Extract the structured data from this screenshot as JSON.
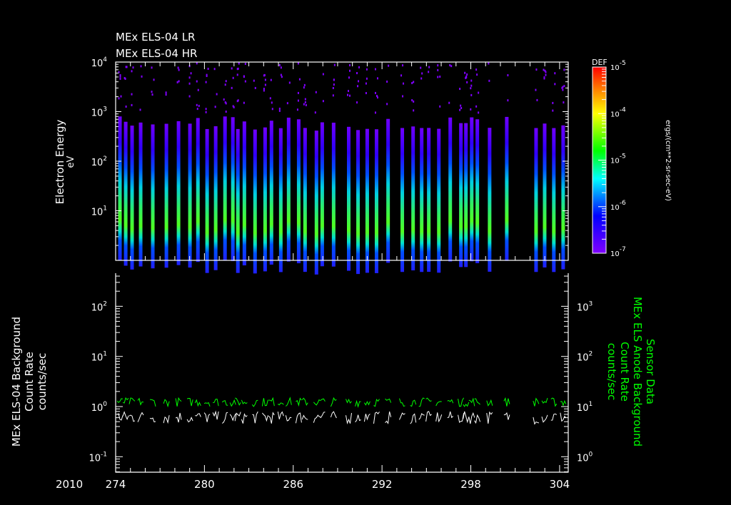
{
  "chart_data": [
    {
      "type": "heatmap",
      "titles": [
        "MEx ELS-04 LR",
        "MEx ELS-04 HR"
      ],
      "ylabel": "Electron Energy",
      "yunits": "eV",
      "yscale": "log",
      "ylim": [
        1,
        10000
      ],
      "yticks": [
        {
          "base": "10",
          "exp": "1"
        },
        {
          "base": "10",
          "exp": "2"
        },
        {
          "base": "10",
          "exp": "3"
        },
        {
          "base": "10",
          "exp": "4"
        }
      ],
      "ytick_values": [
        10,
        100,
        1000,
        10000
      ],
      "xlim": [
        274,
        304.6
      ],
      "pass_days": [
        274.29,
        274.68,
        275.11,
        275.69,
        276.51,
        277.43,
        278.25,
        279.02,
        279.56,
        280.18,
        280.76,
        281.39,
        281.92,
        282.26,
        282.7,
        283.42,
        284.1,
        284.53,
        285.16,
        285.69,
        286.37,
        286.8,
        287.57,
        287.96,
        288.73,
        289.75,
        290.38,
        291.0,
        291.63,
        292.41,
        293.37,
        294.1,
        294.68,
        295.16,
        295.84,
        296.61,
        297.33,
        297.67,
        298.06,
        298.44,
        299.27,
        300.43,
        302.41,
        302.99,
        303.61,
        304.24
      ],
      "band_top_energy_eV": 800,
      "peak_energy_eV": 15,
      "colorbar": {
        "title": "DEF",
        "units": "ergs/(cm**2-sr-sec-eV)",
        "scale": "log",
        "range": [
          1e-07,
          0.001
        ],
        "ticks": [
          {
            "base": "10",
            "exp": "-5"
          },
          {
            "base": "10",
            "exp": "-4"
          },
          {
            "base": "10",
            "exp": "-5"
          },
          {
            "base": "10",
            "exp": "-6"
          },
          {
            "base": "10",
            "exp": "-7"
          }
        ],
        "colors": [
          "#8000ff",
          "#0000ff",
          "#00ffff",
          "#00ff00",
          "#ffff00",
          "#ff8000",
          "#ff0000"
        ]
      }
    },
    {
      "type": "line",
      "ylabel_left": [
        "MEx ELS-04 Background",
        "Count Rate",
        "counts/sec"
      ],
      "ylabel_right": [
        "Sensor Data",
        "MEx ELS Anode Background",
        "Count Rate",
        "counts/sec"
      ],
      "ylim_left": [
        0.05,
        450
      ],
      "ylim_right": [
        0.5,
        4500
      ],
      "yticks_left": [
        {
          "base": "10",
          "exp": "-1"
        },
        {
          "base": "10",
          "exp": "0"
        },
        {
          "base": "10",
          "exp": "1"
        },
        {
          "base": "10",
          "exp": "2"
        }
      ],
      "yticks_right": [
        {
          "base": "10",
          "exp": "0"
        },
        {
          "base": "10",
          "exp": "1"
        },
        {
          "base": "10",
          "exp": "2"
        },
        {
          "base": "10",
          "exp": "3"
        }
      ],
      "series": [
        {
          "name": "MEx ELS-04 Background",
          "axis": "left",
          "color": "#ffffff",
          "typical_value": 0.6,
          "range": [
            0.45,
            0.8
          ]
        },
        {
          "name": "MEx ELS Anode Background",
          "axis": "right",
          "color": "#00ff00",
          "typical_value": 12,
          "range": [
            10,
            15
          ]
        }
      ],
      "xlabel_year": "2010",
      "xticks": [
        "274",
        "280",
        "286",
        "292",
        "298",
        "304"
      ],
      "xtick_values": [
        274,
        280,
        286,
        292,
        298,
        304
      ]
    }
  ]
}
